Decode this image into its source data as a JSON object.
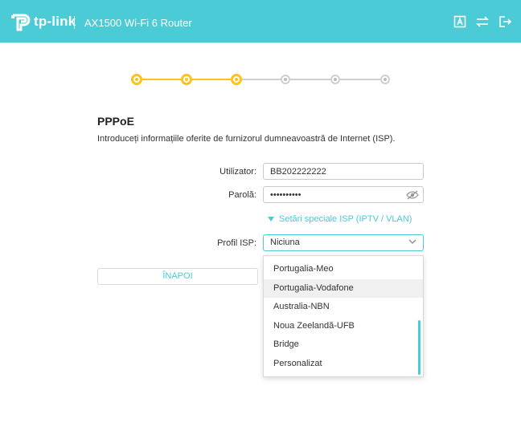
{
  "header": {
    "brand": "tp-link",
    "title": "AX1500 Wi-Fi 6 Router",
    "icons": [
      "language-icon",
      "switch-mode-icon",
      "logout-icon"
    ],
    "colors": {
      "bar": "#4acbd6",
      "text": "#ffffff"
    }
  },
  "stepper": {
    "total_steps": 6,
    "completed_steps": 3,
    "colors": {
      "active": "#ffc21b",
      "inactive": "#cfcfcf"
    }
  },
  "form": {
    "title": "PPPoE",
    "description": "Introduceți informațiile oferite de furnizorul dumneavoastră de Internet (ISP).",
    "username_label": "Utilizator:",
    "username_value": "BB202222222",
    "password_label": "Parolă:",
    "password_value": "••••••••••",
    "advanced_link": "Setări speciale ISP (IPTV / VLAN)",
    "isp_profile_label": "Profil ISP:",
    "isp_profile_value": "Niciuna"
  },
  "buttons": {
    "back": "ÎNAPOI"
  },
  "dropdown": {
    "options": [
      "Portugalia-Meo",
      "Portugalia-Vodafone",
      "Australia-NBN",
      "Noua Zeelandă-UFB",
      "Bridge",
      "Personalizat"
    ],
    "hovered": "Portugalia-Vodafone"
  }
}
